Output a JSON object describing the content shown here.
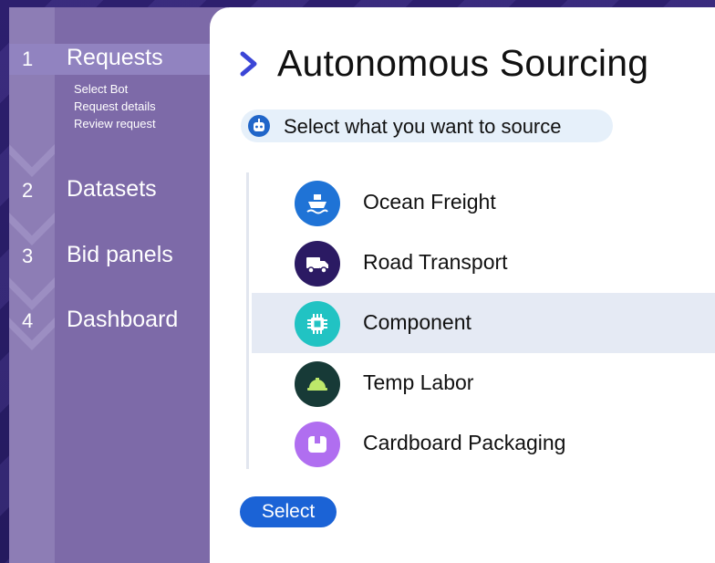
{
  "sidebar": {
    "steps": [
      {
        "num": "1",
        "label": "Requests",
        "substeps": [
          "Select Bot",
          "Request details",
          "Review request"
        ]
      },
      {
        "num": "2",
        "label": "Datasets"
      },
      {
        "num": "3",
        "label": "Bid panels"
      },
      {
        "num": "4",
        "label": "Dashboard"
      }
    ]
  },
  "main": {
    "title": "Autonomous Sourcing",
    "prompt": "Select what you want to source",
    "items": [
      {
        "label": "Ocean Freight",
        "icon": "ship-icon",
        "color": "#1f73d6"
      },
      {
        "label": "Road Transport",
        "icon": "truck-icon",
        "color": "#2b1a63"
      },
      {
        "label": "Component",
        "icon": "chip-icon",
        "color": "#21c3c3"
      },
      {
        "label": "Temp Labor",
        "icon": "hard-hat-icon",
        "color": "#173a37"
      },
      {
        "label": "Cardboard Packaging",
        "icon": "package-icon",
        "color": "#b06ef0"
      }
    ],
    "selected_index": 2,
    "select_button": "Select"
  },
  "colors": {
    "accent": "#1b63d6",
    "sidebar": "#7d6aa8",
    "selected_row": "#e5eaf4"
  }
}
